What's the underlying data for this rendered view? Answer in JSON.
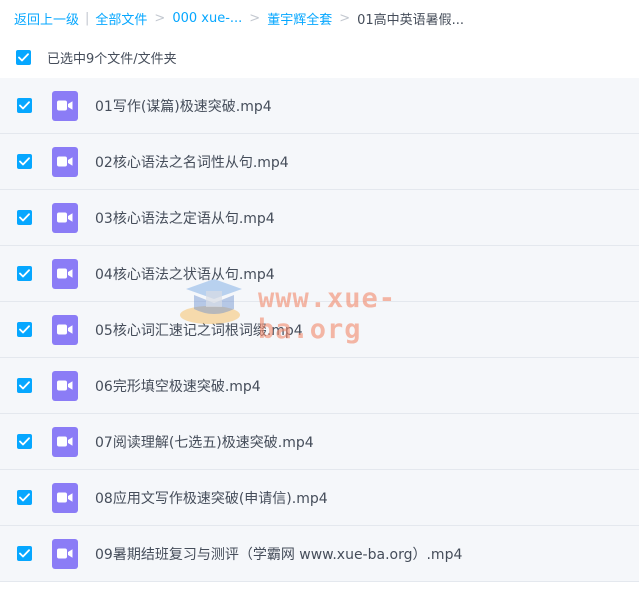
{
  "breadcrumb": {
    "back": "返回上一级",
    "separator": "|",
    "arrow": ">",
    "items": [
      "全部文件",
      "000 xue-...",
      "董宇辉全套"
    ],
    "current": "01高中英语暑假..."
  },
  "selection": {
    "checked": true,
    "label": "已选中9个文件/文件夹"
  },
  "files": [
    {
      "name": "01写作(谋篇)极速突破.mp4",
      "checked": true,
      "icon": "video-file-icon"
    },
    {
      "name": "02核心语法之名词性从句.mp4",
      "checked": true,
      "icon": "video-file-icon"
    },
    {
      "name": "03核心语法之定语从句.mp4",
      "checked": true,
      "icon": "video-file-icon"
    },
    {
      "name": "04核心语法之状语从句.mp4",
      "checked": true,
      "icon": "video-file-icon"
    },
    {
      "name": "05核心词汇速记之词根词缀.mp4",
      "checked": true,
      "icon": "video-file-icon"
    },
    {
      "name": "06完形填空极速突破.mp4",
      "checked": true,
      "icon": "video-file-icon"
    },
    {
      "name": "07阅读理解(七选五)极速突破.mp4",
      "checked": true,
      "icon": "video-file-icon"
    },
    {
      "name": "08应用文写作极速突破(申请信).mp4",
      "checked": true,
      "icon": "video-file-icon"
    },
    {
      "name": "09暑期结班复习与测评（学霸网 www.xue-ba.org）.mp4",
      "checked": true,
      "icon": "video-file-icon"
    }
  ],
  "watermark": {
    "text": "www.xue-ba.org"
  },
  "colors": {
    "accent": "#06a7ff",
    "video_icon": "#8b7cf6",
    "text": "#454d5a",
    "row_background": "#f5f7fa",
    "watermark": "#f28a6c"
  }
}
